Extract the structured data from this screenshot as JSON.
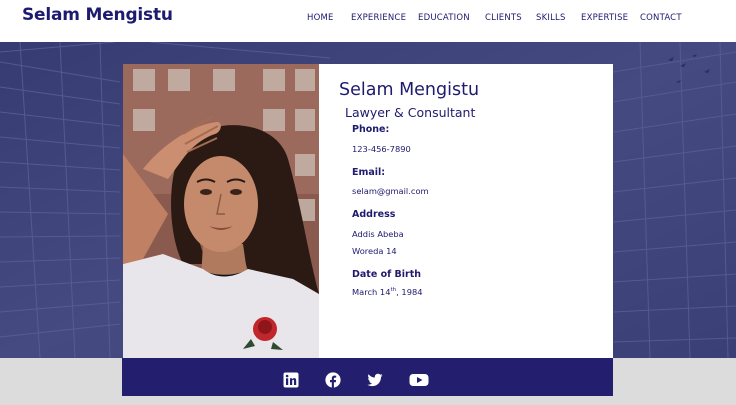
{
  "header": {
    "brand": "Selam Mengistu",
    "nav": [
      "HOME",
      "EXPERIENCE",
      "EDUCATION",
      "CLIENTS",
      "SKILLS",
      "EXPERTISE",
      "CONTACT"
    ]
  },
  "profile": {
    "name": "Selam Mengistu",
    "title": "Lawyer & Consultant",
    "phone_label": "Phone:",
    "phone": "123-456-7890",
    "email_label": "Email:",
    "email": "selam@gmail.com",
    "address_label": "Address",
    "address_line1": "Addis Abeba",
    "address_line2": "Woreda 14",
    "dob_label": "Date of Birth",
    "dob_month": "March 14",
    "dob_suffix": "th",
    "dob_year": ", 1984"
  },
  "social": [
    "linkedin-icon",
    "facebook-icon",
    "twitter-icon",
    "youtube-icon"
  ],
  "colors": {
    "brand": "#1e1a6e",
    "hero_bg": "#40467c",
    "social_bar": "#231f6e",
    "strip": "#dcdcdc"
  }
}
